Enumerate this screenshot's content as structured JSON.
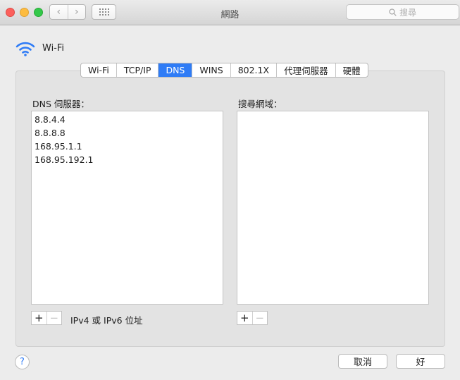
{
  "window": {
    "title": "網路"
  },
  "toolbar": {
    "search_placeholder": "搜尋"
  },
  "header": {
    "interface_name": "Wi-Fi",
    "icon": "wifi-icon"
  },
  "tabs": [
    {
      "label": "Wi-Fi",
      "active": false
    },
    {
      "label": "TCP/IP",
      "active": false
    },
    {
      "label": "DNS",
      "active": true
    },
    {
      "label": "WINS",
      "active": false
    },
    {
      "label": "802.1X",
      "active": false
    },
    {
      "label": "代理伺服器",
      "active": false
    },
    {
      "label": "硬體",
      "active": false
    }
  ],
  "dns": {
    "servers_label": "DNS 伺服器：",
    "servers": [
      "8.8.4.4",
      "8.8.8.8",
      "168.95.1.1",
      "168.95.192.1"
    ],
    "search_domains_label": "搜尋網域：",
    "search_domains": [],
    "hint": "IPv4 或 IPv6 位址"
  },
  "buttons": {
    "add": "+",
    "remove": "−",
    "help": "?",
    "cancel": "取消",
    "ok": "好"
  },
  "colors": {
    "accent": "#2f7cf6"
  }
}
